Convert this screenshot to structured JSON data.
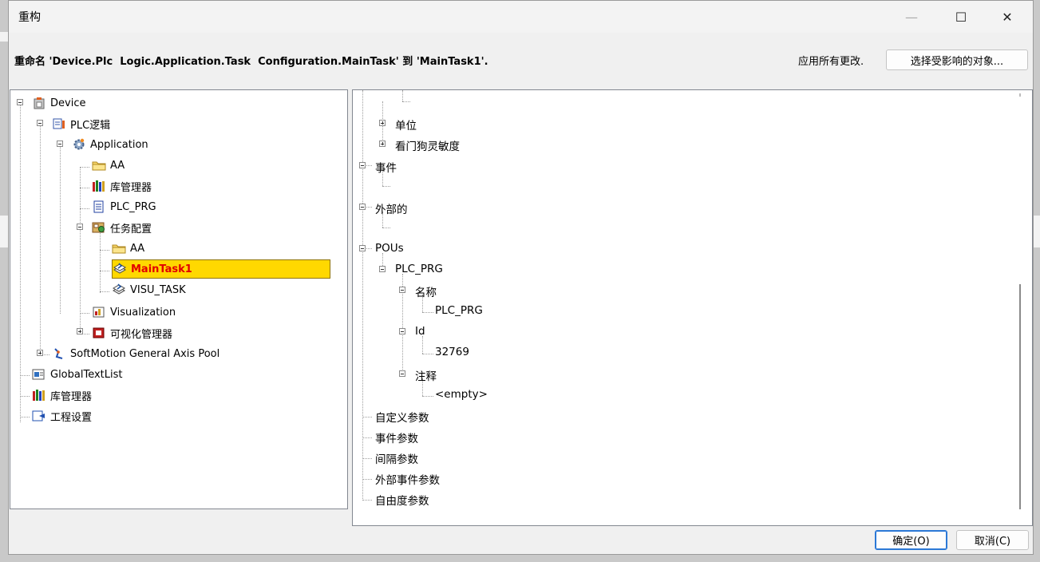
{
  "window": {
    "title": "重构",
    "minimize_glyph": "—",
    "maximize_glyph": "☐",
    "close_glyph": "✕"
  },
  "header": {
    "description": "重命名 'Device.Plc  Logic.Application.Task  Configuration.MainTask' 到 'MainTask1'.",
    "apply_all": "应用所有更改.",
    "select_affected": "选择受影响的对象..."
  },
  "tree": {
    "device": "Device",
    "plc_logic": "PLC逻辑",
    "application": "Application",
    "aa_folder": "AA",
    "library_manager_app": "库管理器",
    "plc_prg": "PLC_PRG",
    "task_config": "任务配置",
    "task_aa": "AA",
    "maintask1": "MainTask1",
    "visu_task": "VISU_TASK",
    "visualization": "Visualization",
    "visu_manager": "可视化管理器",
    "softmotion_pool": "SoftMotion General Axis Pool",
    "global_text_list": "GlobalTextList",
    "library_manager": "库管理器",
    "project_settings": "工程设置"
  },
  "detail": {
    "unit": "单位",
    "watchdog_sensitivity": "看门狗灵敏度",
    "event": "事件",
    "external": "外部的",
    "pous": "POUs",
    "pou_plc_prg": "PLC_PRG",
    "name_label": "名称",
    "name_value": "PLC_PRG",
    "id_label": "Id",
    "id_value": "32769",
    "comment_label": "注释",
    "comment_value": "<empty>",
    "custom_params": "自定义参数",
    "event_params": "事件参数",
    "interval_params": "间隔参数",
    "external_event_params": "外部事件参数",
    "freedom_params": "自由度参数"
  },
  "footer": {
    "ok": "确定(O)",
    "cancel": "取消(C)"
  },
  "colors": {
    "selection_bg": "#ffd800",
    "selection_text": "#e20000",
    "primary_border": "#2b78d6"
  }
}
